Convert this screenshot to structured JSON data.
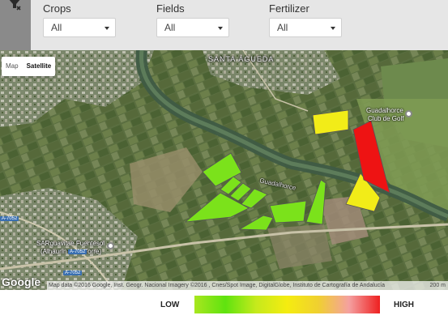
{
  "filters": [
    {
      "label": "Crops",
      "value": "All"
    },
    {
      "label": "Fields",
      "value": "All"
    },
    {
      "label": "Fertilizer",
      "value": "All"
    }
  ],
  "map": {
    "type_buttons": [
      "Map",
      "Satellite"
    ],
    "active_type": "Satellite",
    "labels": {
      "santa_agueda": "SANTA ÁGUEDA",
      "guadalhorce_club_1": "Guadalhorce",
      "guadalhorce_club_2": "Club de Golf",
      "river": "Guadalhorce",
      "poi_1": "SARquavitae Fuentesol",
      "poi_2": "(Alhaurín de la Torre)",
      "road_a7052_left": "A-7052",
      "road_a7052": "A-7052",
      "road_7052": "A-7052"
    },
    "google": "Google",
    "attribution": "Map data ©2016 Google, Inst. Geogr. Nacional Imagery ©2016 , Cnes/Spot Image, DigitalGlobe, Instituto de Cartografía de Andalucía",
    "scale": "200 m"
  },
  "fields": [
    {
      "level": "low",
      "color": "#7be21b"
    },
    {
      "level": "low",
      "color": "#7be21b"
    },
    {
      "level": "low",
      "color": "#7be21b"
    },
    {
      "level": "low",
      "color": "#7be21b"
    },
    {
      "level": "low",
      "color": "#7be21b"
    },
    {
      "level": "low",
      "color": "#7be21b"
    },
    {
      "level": "low",
      "color": "#7be21b"
    },
    {
      "level": "low",
      "color": "#7be21b"
    },
    {
      "level": "medium",
      "color": "#f2ec18"
    },
    {
      "level": "medium",
      "color": "#f2ec18"
    },
    {
      "level": "high",
      "color": "#ee1313"
    }
  ],
  "legend": {
    "low": "LOW",
    "high": "HIGH",
    "colors": [
      "#a8e61f",
      "#5fe30f",
      "#c6ea1c",
      "#f5ec10",
      "#f0d030",
      "#f4a0a0",
      "#ee2020"
    ]
  }
}
